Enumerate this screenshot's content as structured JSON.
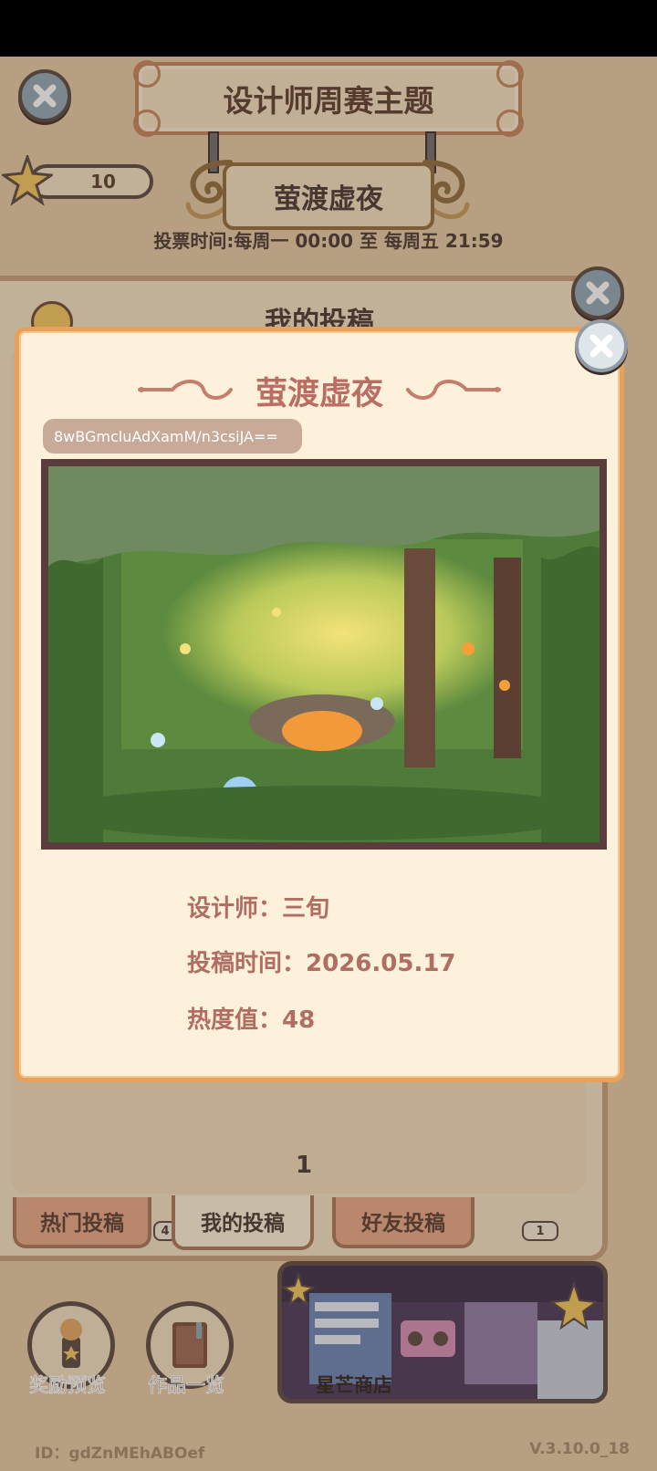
{
  "header": {
    "title": "设计师周赛主题",
    "star_count": "10",
    "theme_name": "萤渡虚夜",
    "vote_time": "投票时间:每周一 00:00 至 每周五 21:59"
  },
  "panel": {
    "title": "我的投稿",
    "page_number": "1"
  },
  "tabs": [
    {
      "label": "热门投稿",
      "active": false
    },
    {
      "label": "我的投稿",
      "active": true
    },
    {
      "label": "好友投稿",
      "active": false
    }
  ],
  "badges": [
    "4",
    "1"
  ],
  "bottom": {
    "rewards_label": "奖励预览",
    "works_label": "作品一览",
    "shop_label": "星芒商店"
  },
  "footer": {
    "id_text": "ID：gdZnMEhABOef",
    "version": "V.3.10.0_18"
  },
  "modal": {
    "title": "萤渡虚夜",
    "code": "8wBGmcluAdXamM/n3csiJA==",
    "designer_label": "设计师：",
    "designer": "三旬",
    "submit_time_label": "投稿时间：",
    "submit_time": "2026.05.17",
    "heat_label": "热度值：",
    "heat": "48"
  },
  "colors": {
    "accent_title": "#b96e63",
    "modal_border": "#e8a15b",
    "close_button": "#8fa8b8"
  },
  "icons": [
    "close-icon",
    "star-icon",
    "info-icon",
    "trophy-icon",
    "book-icon"
  ]
}
